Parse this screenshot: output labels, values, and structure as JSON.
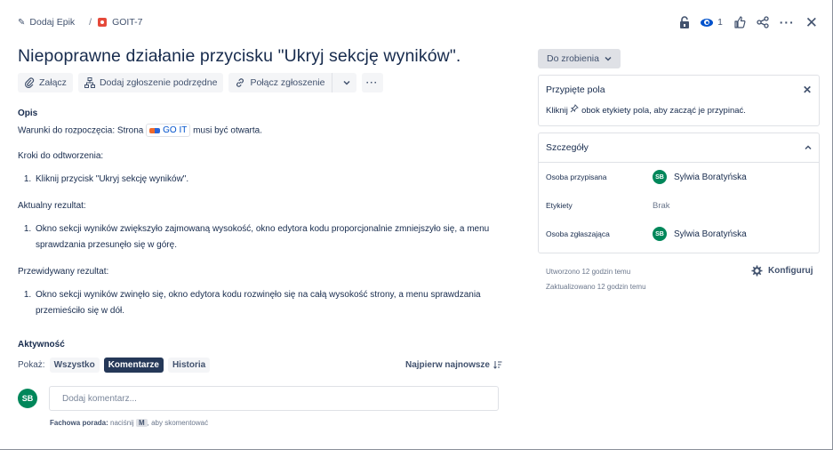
{
  "breadcrumb": {
    "epic_label": "Dodaj Epik",
    "separator": "/",
    "issue_key": "GOIT-7"
  },
  "top_actions": {
    "watch_count": "1",
    "icons": [
      "lock-icon",
      "eye-icon",
      "thumbs-up-icon",
      "share-icon",
      "more-icon",
      "close-icon"
    ]
  },
  "issue": {
    "title": "Niepoprawne działanie przycisku \"Ukryj sekcję wyników\"."
  },
  "toolbar": {
    "attach": "Załącz",
    "add_child": "Dodaj zgłoszenie podrzędne",
    "link_issue": "Połącz zgłoszenie",
    "more": "···"
  },
  "description": {
    "heading": "Opis",
    "preconditions_prefix": "Warunki do rozpoczęcia: Strona",
    "preconditions_link": "GO IT",
    "preconditions_suffix": "musi być otwarta.",
    "steps_heading": "Kroki do odtworzenia:",
    "steps": [
      "Kliknij przycisk \"Ukryj sekcję wyników\"."
    ],
    "actual_heading": "Aktualny rezultat:",
    "actual": [
      "Okno sekcji wyników zwiększyło zajmowaną wysokość, okno edytora kodu proporcjonalnie zmniejszyło się, a menu sprawdzania przesunęło się w górę."
    ],
    "expected_heading": "Przewidywany rezultat:",
    "expected": [
      "Okno sekcji wyników zwinęło się, okno edytora kodu rozwinęło się na całą wysokość strony, a menu sprawdzania przemieściło się w dół."
    ]
  },
  "activity": {
    "heading": "Aktywność",
    "show_label": "Pokaż:",
    "filters": [
      "Wszystko",
      "Komentarze",
      "Historia"
    ],
    "active_filter": "Komentarze",
    "sort_label": "Najpierw najnowsze"
  },
  "comment": {
    "avatar_initials": "SB",
    "placeholder": "Dodaj komentarz...",
    "protip_bold": "Fachowa porada:",
    "protip_prefix": "naciśnij",
    "protip_key": "M",
    "protip_suffix": ", aby skomentować"
  },
  "sidebar": {
    "status": "Do zrobienia",
    "pinned": {
      "title": "Przypięte pola",
      "hint_prefix": "Kliknij",
      "hint_suffix": "obok etykiety pola, aby zacząć je przypinać."
    },
    "details": {
      "title": "Szczegóły",
      "rows": [
        {
          "label": "Osoba przypisana",
          "initials": "SB",
          "value": "Sylwia Boratyńska"
        },
        {
          "label": "Etykiety",
          "value": "Brak"
        },
        {
          "label": "Osoba zgłaszająca",
          "initials": "SB",
          "value": "Sylwia Boratyńska"
        }
      ]
    },
    "created": "Utworzono 12 godzin temu",
    "updated": "Zaktualizowano 12 godzin temu",
    "configure": "Konfiguruj"
  },
  "colors": {
    "accent": "#0052cc",
    "bug": "#e5493a",
    "avatar": "#00875a",
    "active_filter": "#253858"
  }
}
